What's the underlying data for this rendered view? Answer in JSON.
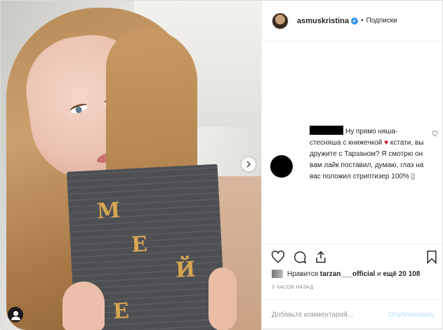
{
  "post": {
    "username": "asmuskristina",
    "verified_mark": "✔",
    "dot": "•",
    "follow_label": "Подписки"
  },
  "photo": {
    "book_letters": [
      "М",
      "Е",
      "Й",
      "Е"
    ]
  },
  "comment": {
    "text_line1": "Ну прямо няша-",
    "text_line2": "стесняша с книжечкой",
    "heart": "♥",
    "text_rest": "кстати, вы дружите с Тарзаном? Я смотрю он вам лайк поставил, думаю, глаз на вас положил стриптизер 100% ",
    "text_tail": "▯"
  },
  "likes": {
    "prefix": "Нравится",
    "user": "tarzan___official",
    "middle": "и",
    "count": "ещё 20 108"
  },
  "timestamp": "3 ЧАСОВ НАЗАД",
  "add_comment": {
    "placeholder": "Добавьте комментарий...",
    "publish_label": "Опубликовать"
  },
  "icons": [
    "heart-icon",
    "comment-icon",
    "share-icon",
    "bookmark-icon",
    "next-arrow-icon",
    "tag-user-icon"
  ]
}
